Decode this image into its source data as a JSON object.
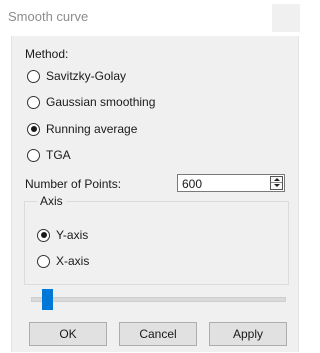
{
  "window": {
    "title": "Smooth curve"
  },
  "method": {
    "label": "Method:",
    "options": [
      {
        "label": "Savitzky-Golay",
        "selected": false
      },
      {
        "label": "Gaussian smoothing",
        "selected": false
      },
      {
        "label": "Running average",
        "selected": true
      },
      {
        "label": "TGA",
        "selected": false
      }
    ]
  },
  "points": {
    "label": "Number of Points:",
    "value": "600"
  },
  "axis": {
    "label": "Axis",
    "options": [
      {
        "label": "Y-axis",
        "selected": true
      },
      {
        "label": "X-axis",
        "selected": false
      }
    ]
  },
  "buttons": {
    "ok": "OK",
    "cancel": "Cancel",
    "apply": "Apply"
  }
}
